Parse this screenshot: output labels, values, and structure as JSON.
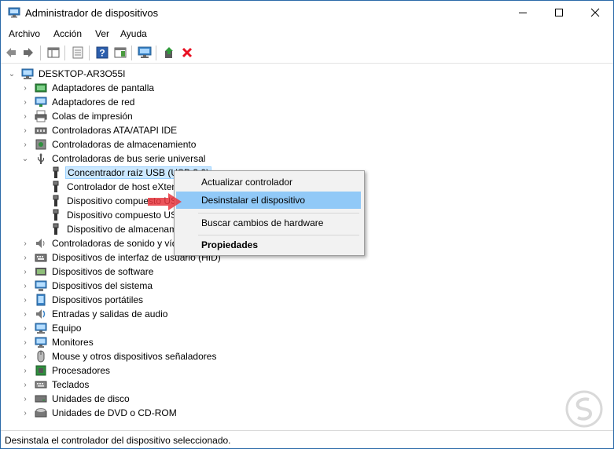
{
  "window": {
    "title": "Administrador de dispositivos"
  },
  "menu": [
    "Archivo",
    "Acción",
    "Ver",
    "Ayuda"
  ],
  "tree": {
    "root": "DESKTOP-AR3O55I",
    "categories": [
      {
        "label": "Adaptadores de pantalla",
        "icon": "display-adapter-icon"
      },
      {
        "label": "Adaptadores de red",
        "icon": "network-adapter-icon"
      },
      {
        "label": "Colas de impresión",
        "icon": "print-queue-icon"
      },
      {
        "label": "Controladoras ATA/ATAPI IDE",
        "icon": "ide-controller-icon"
      },
      {
        "label": "Controladoras de almacenamiento",
        "icon": "storage-controller-icon"
      },
      {
        "label": "Controladoras de bus serie universal",
        "icon": "usb-icon"
      }
    ],
    "usb_children": [
      "Concentrador raíz USB (USB 3.0)",
      "Controlador de host eXtensible",
      "Dispositivo compuesto USB",
      "Dispositivo compuesto USB",
      "Dispositivo de almacenamiento"
    ],
    "categories_after": [
      {
        "label": "Controladoras de sonido y vídeo",
        "icon": "sound-icon"
      },
      {
        "label": "Dispositivos de interfaz de usuario (HID)",
        "icon": "hid-icon"
      },
      {
        "label": "Dispositivos de software",
        "icon": "software-device-icon"
      },
      {
        "label": "Dispositivos del sistema",
        "icon": "system-device-icon"
      },
      {
        "label": "Dispositivos portátiles",
        "icon": "portable-device-icon"
      },
      {
        "label": "Entradas y salidas de audio",
        "icon": "audio-io-icon"
      },
      {
        "label": "Equipo",
        "icon": "computer-icon"
      },
      {
        "label": "Monitores",
        "icon": "monitor-icon"
      },
      {
        "label": "Mouse y otros dispositivos señaladores",
        "icon": "mouse-icon"
      },
      {
        "label": "Procesadores",
        "icon": "processor-icon"
      },
      {
        "label": "Teclados",
        "icon": "keyboard-icon"
      },
      {
        "label": "Unidades de disco",
        "icon": "disk-drive-icon"
      },
      {
        "label": "Unidades de DVD o CD-ROM",
        "icon": "dvd-icon"
      }
    ]
  },
  "context_menu": {
    "items": [
      "Actualizar controlador",
      "Desinstalar el dispositivo",
      "Buscar cambios de hardware",
      "Propiedades"
    ]
  },
  "status": "Desinstala el controlador del dispositivo seleccionado.",
  "colors": {
    "highlight": "#91c9f7",
    "selection": "#cce8ff",
    "arrow": "#e8363e",
    "delete_icon": "#e81123"
  }
}
